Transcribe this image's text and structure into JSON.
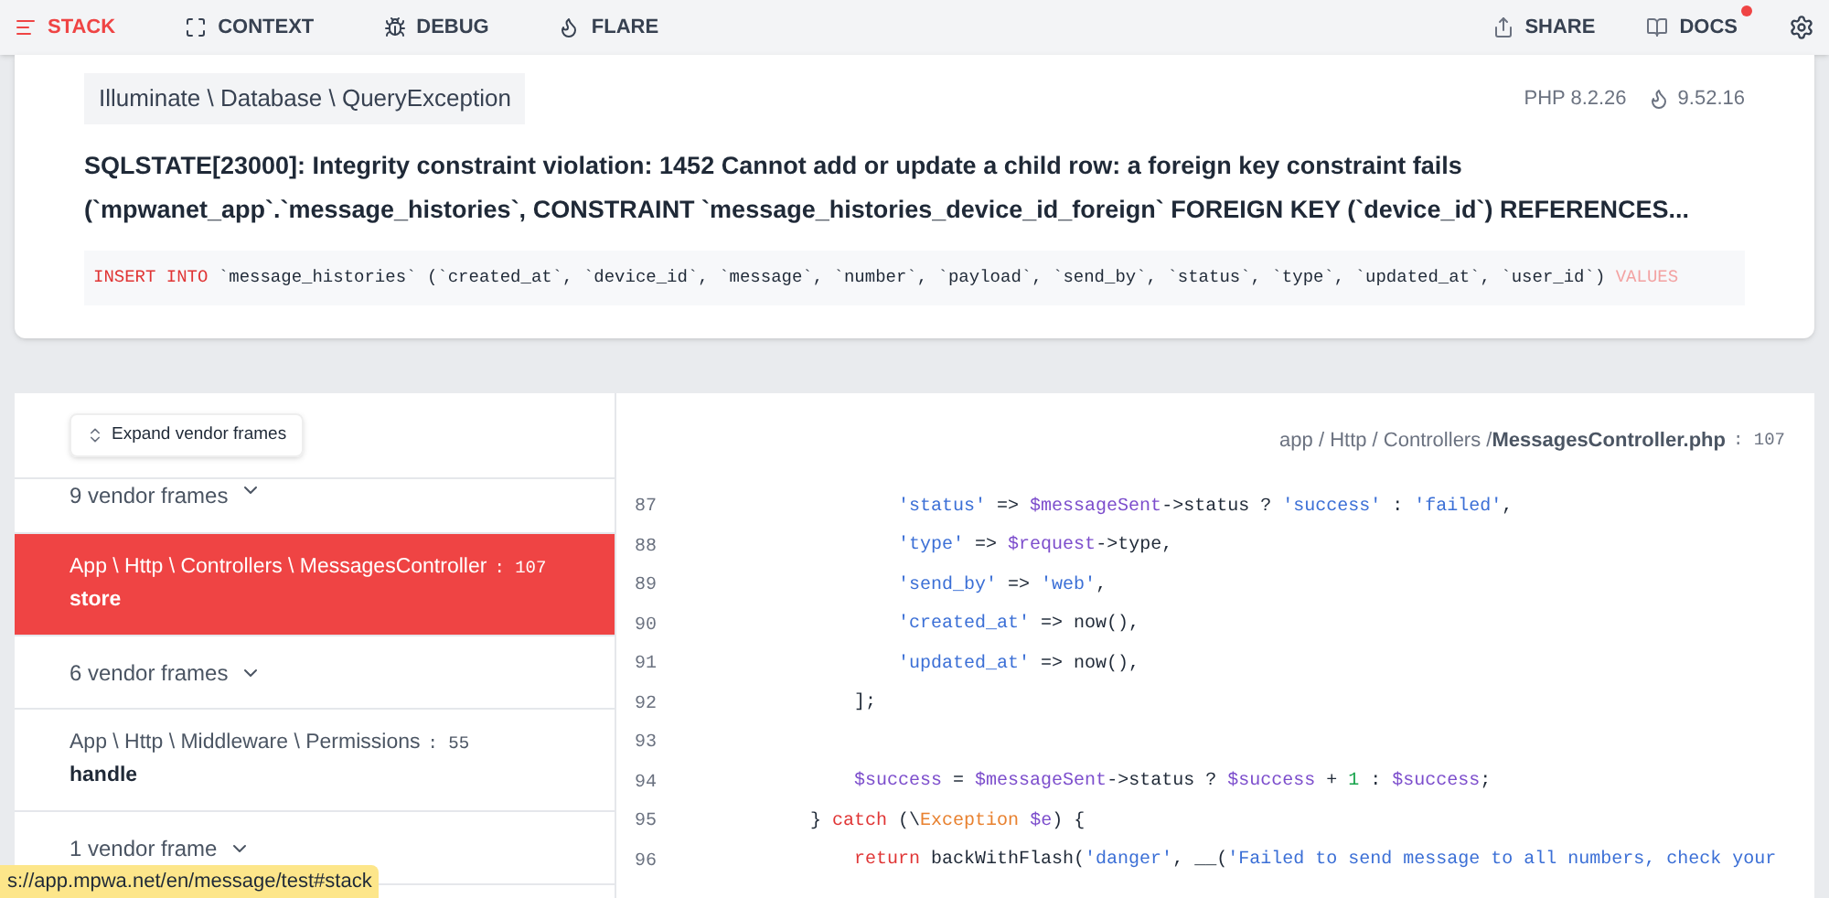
{
  "nav": {
    "tabs": [
      {
        "label": "STACK",
        "selected": true
      },
      {
        "label": "CONTEXT",
        "selected": false
      },
      {
        "label": "DEBUG",
        "selected": false
      },
      {
        "label": "FLARE",
        "selected": false
      }
    ],
    "actions": [
      {
        "label": "SHARE",
        "badge": false
      },
      {
        "label": "DOCS",
        "badge": true
      }
    ]
  },
  "exception": {
    "class": "Illuminate \\ Database \\ QueryException",
    "php_version": "PHP 8.2.26",
    "laravel_version": "9.52.16",
    "message": "SQLSTATE[23000]: Integrity constraint violation: 1452 Cannot add or update a child row: a foreign key constraint fails (`mpwanet_app`.`message_histories`, CONSTRAINT `message_histories_device_id_foreign` FOREIGN KEY (`device_id`) REFERENCES...",
    "sql": [
      {
        "kind": "kw",
        "text": "INSERT INTO"
      },
      {
        "kind": "plain",
        "text": " `message_histories` (`created_at`, `device_id`, `message`, `number`, `payload`, `send_by`, `status`, `type`, `updated_at`, `user_id`) "
      },
      {
        "kind": "fade",
        "text": "VALUES"
      }
    ]
  },
  "frames": {
    "expand_button": "Expand vendor frames",
    "items": [
      {
        "kind": "vendor",
        "label": "9 vendor frames"
      },
      {
        "kind": "app",
        "path": "App \\ Http \\ Controllers \\ MessagesController",
        "line": ": 107",
        "method": "store",
        "selected": true
      },
      {
        "kind": "vendor",
        "label": "6 vendor frames"
      },
      {
        "kind": "app",
        "path": "App \\ Http \\ Middleware \\ Permissions",
        "line": ": 55",
        "method": "handle",
        "selected": false
      },
      {
        "kind": "vendor",
        "label": "1 vendor frame"
      }
    ]
  },
  "code": {
    "path": "app / Http / Controllers / ",
    "file": "MessagesController.php",
    "line": ": 107",
    "lines": [
      {
        "number": "87",
        "tokens": [
          {
            "kind": "str",
            "text": "                'status'"
          },
          {
            "kind": "plain",
            "text": " => "
          },
          {
            "kind": "var",
            "text": "$messageSent"
          },
          {
            "kind": "plain",
            "text": "->status ? "
          },
          {
            "kind": "str",
            "text": "'success'"
          },
          {
            "kind": "plain",
            "text": " : "
          },
          {
            "kind": "str",
            "text": "'failed'"
          },
          {
            "kind": "plain",
            "text": ","
          }
        ]
      },
      {
        "number": "88",
        "tokens": [
          {
            "kind": "str",
            "text": "                'type'"
          },
          {
            "kind": "plain",
            "text": " => "
          },
          {
            "kind": "var",
            "text": "$request"
          },
          {
            "kind": "plain",
            "text": "->type,"
          }
        ]
      },
      {
        "number": "89",
        "tokens": [
          {
            "kind": "str",
            "text": "                'send_by'"
          },
          {
            "kind": "plain",
            "text": " => "
          },
          {
            "kind": "str",
            "text": "'web'"
          },
          {
            "kind": "plain",
            "text": ","
          }
        ]
      },
      {
        "number": "90",
        "tokens": [
          {
            "kind": "str",
            "text": "                'created_at'"
          },
          {
            "kind": "plain",
            "text": " => now(),"
          }
        ]
      },
      {
        "number": "91",
        "tokens": [
          {
            "kind": "str",
            "text": "                'updated_at'"
          },
          {
            "kind": "plain",
            "text": " => now(),"
          }
        ]
      },
      {
        "number": "92",
        "tokens": [
          {
            "kind": "plain",
            "text": "            ];"
          }
        ]
      },
      {
        "number": "93"
      },
      {
        "number": "94",
        "tokens": [
          {
            "kind": "var",
            "text": "            $success"
          },
          {
            "kind": "plain",
            "text": " = "
          },
          {
            "kind": "var",
            "text": "$messageSent"
          },
          {
            "kind": "plain",
            "text": "->status ? "
          },
          {
            "kind": "var",
            "text": "$success"
          },
          {
            "kind": "plain",
            "text": " + "
          },
          {
            "kind": "num",
            "text": "1"
          },
          {
            "kind": "plain",
            "text": " : "
          },
          {
            "kind": "var",
            "text": "$success"
          },
          {
            "kind": "plain",
            "text": ";"
          }
        ]
      },
      {
        "number": "95",
        "tokens": [
          {
            "kind": "plain",
            "text": "        } "
          },
          {
            "kind": "kw",
            "text": "catch"
          },
          {
            "kind": "plain",
            "text": " (\\"
          },
          {
            "kind": "cls",
            "text": "Exception"
          },
          {
            "kind": "var",
            "text": " $e"
          },
          {
            "kind": "plain",
            "text": ") {"
          }
        ]
      },
      {
        "number": "96",
        "tokens": [
          {
            "kind": "kw",
            "text": "            return"
          },
          {
            "kind": "plain",
            "text": " backWithFlash("
          },
          {
            "kind": "str",
            "text": "'danger'"
          },
          {
            "kind": "plain",
            "text": ", __("
          },
          {
            "kind": "str",
            "text": "'Failed to send message to all numbers, check your"
          }
        ]
      }
    ]
  },
  "status_url": "s://app.mpwa.net/en/message/test#stack"
}
